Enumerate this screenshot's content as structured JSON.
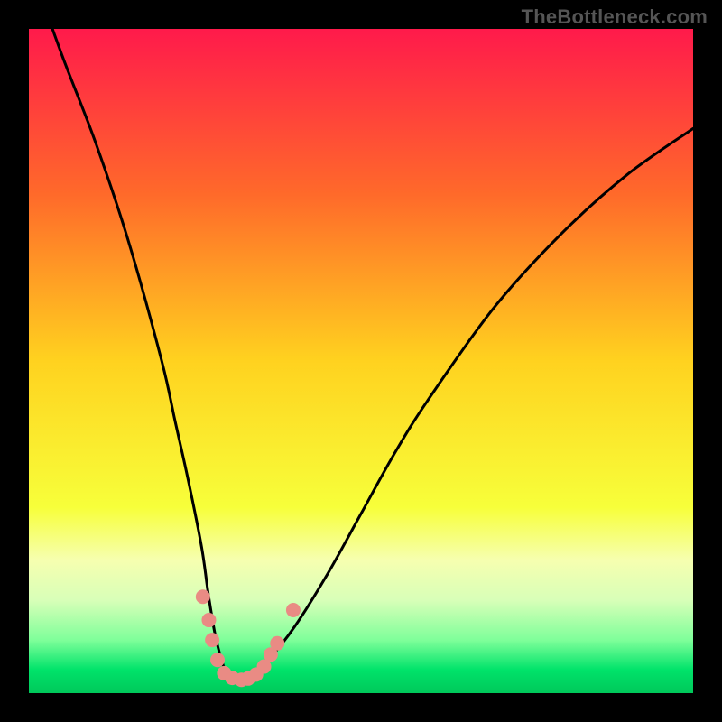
{
  "watermark": "TheBottleneck.com",
  "chart_data": {
    "type": "line",
    "title": "",
    "xlabel": "",
    "ylabel": "",
    "xlim": [
      0,
      100
    ],
    "ylim": [
      0,
      100
    ],
    "gradient_stops": [
      {
        "offset": 0,
        "color": "#ff1a4b"
      },
      {
        "offset": 0.25,
        "color": "#ff6a2a"
      },
      {
        "offset": 0.5,
        "color": "#ffd21f"
      },
      {
        "offset": 0.72,
        "color": "#f7ff3a"
      },
      {
        "offset": 0.8,
        "color": "#f6ffb0"
      },
      {
        "offset": 0.86,
        "color": "#d8ffb8"
      },
      {
        "offset": 0.92,
        "color": "#7fff9a"
      },
      {
        "offset": 0.965,
        "color": "#00e36a"
      },
      {
        "offset": 1.0,
        "color": "#00c85a"
      }
    ],
    "series": [
      {
        "name": "bottleneck-curve",
        "x": [
          0,
          5,
          10,
          15,
          20,
          22,
          24,
          26,
          27,
          28,
          29,
          30,
          31.5,
          33,
          36,
          40,
          45,
          50,
          55,
          60,
          70,
          80,
          90,
          100
        ],
        "values": [
          110,
          96,
          83,
          68,
          50,
          41,
          32,
          22,
          15,
          9,
          5,
          2.5,
          2,
          2.5,
          5,
          10,
          18,
          27,
          36,
          44,
          58,
          69,
          78,
          85
        ]
      }
    ],
    "markers": {
      "name": "highlight-dots",
      "color": "#e98b84",
      "radius": 8,
      "points": [
        {
          "x": 26.2,
          "y": 14.5
        },
        {
          "x": 27.1,
          "y": 11.0
        },
        {
          "x": 27.6,
          "y": 8.0
        },
        {
          "x": 28.4,
          "y": 5.0
        },
        {
          "x": 29.4,
          "y": 3.0
        },
        {
          "x": 30.6,
          "y": 2.3
        },
        {
          "x": 32.0,
          "y": 2.0
        },
        {
          "x": 33.0,
          "y": 2.2
        },
        {
          "x": 34.2,
          "y": 2.8
        },
        {
          "x": 35.4,
          "y": 4.0
        },
        {
          "x": 36.4,
          "y": 5.8
        },
        {
          "x": 37.4,
          "y": 7.5
        },
        {
          "x": 39.8,
          "y": 12.5
        }
      ]
    }
  }
}
